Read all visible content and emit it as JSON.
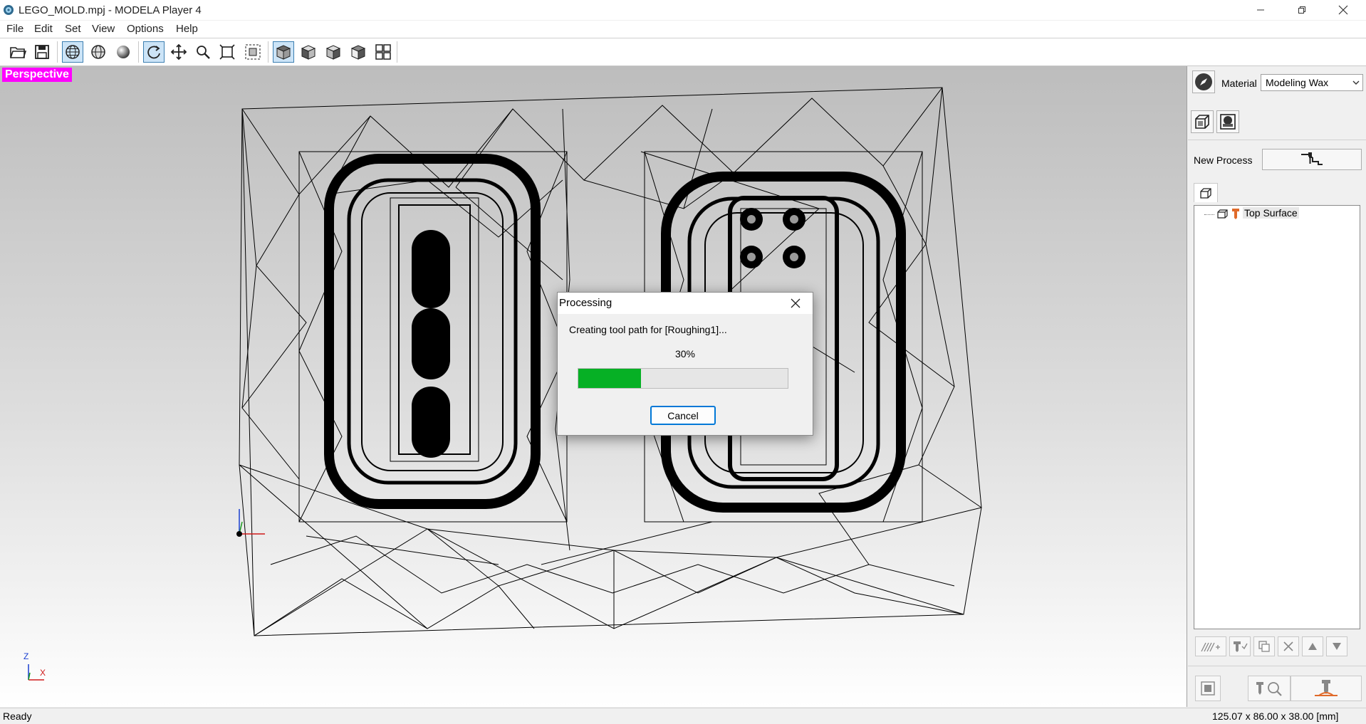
{
  "window": {
    "title": "LEGO_MOLD.mpj - MODELA Player 4",
    "minimize_icon": "minimize-icon",
    "maximize_icon": "restore-icon",
    "close_icon": "close-icon"
  },
  "menu": {
    "items": [
      {
        "label": "File"
      },
      {
        "label": "Edit"
      },
      {
        "label": "Set"
      },
      {
        "label": "View"
      },
      {
        "label": "Options"
      },
      {
        "label": "Help"
      }
    ]
  },
  "toolbar": {
    "buttons": [
      {
        "icon": "open-folder-icon",
        "active": false
      },
      {
        "icon": "save-icon",
        "active": false
      },
      {
        "icon": "wireframe-globe-icon",
        "active": true
      },
      {
        "icon": "hidden-line-globe-icon",
        "active": false
      },
      {
        "icon": "shaded-sphere-icon",
        "active": false
      },
      {
        "icon": "rotate-icon",
        "active": true
      },
      {
        "icon": "pan-icon",
        "active": false
      },
      {
        "icon": "zoom-icon",
        "active": false
      },
      {
        "icon": "fit-all-icon",
        "active": false
      },
      {
        "icon": "zoom-window-icon",
        "active": false
      },
      {
        "icon": "view-top-cube-icon",
        "active": true
      },
      {
        "icon": "view-front-cube-icon",
        "active": false
      },
      {
        "icon": "view-side-cube-icon",
        "active": false
      },
      {
        "icon": "view-iso-cube-icon",
        "active": false
      },
      {
        "icon": "multi-view-icon",
        "active": false
      }
    ]
  },
  "viewport": {
    "view_label": "Perspective",
    "axis_z": "Z",
    "axis_x": "X"
  },
  "panel": {
    "material_label": "Material",
    "material_value": "Modeling Wax",
    "new_process_label": "New Process",
    "tree_items": [
      {
        "label": "Top Surface"
      }
    ]
  },
  "dialog": {
    "title": "Processing",
    "message": "Creating tool path for [Roughing1]...",
    "percent_text": "30%",
    "progress": 0.3,
    "cancel_label": "Cancel"
  },
  "status": {
    "left": "Ready",
    "right": "125.07 x 86.00 x 38.00 [mm]"
  },
  "colors": {
    "perspective_label_bg": "#ff00ff",
    "progress_fill": "#06b025",
    "active_tool_bg": "#cce4f7",
    "dialog_button_border": "#0078d7"
  }
}
